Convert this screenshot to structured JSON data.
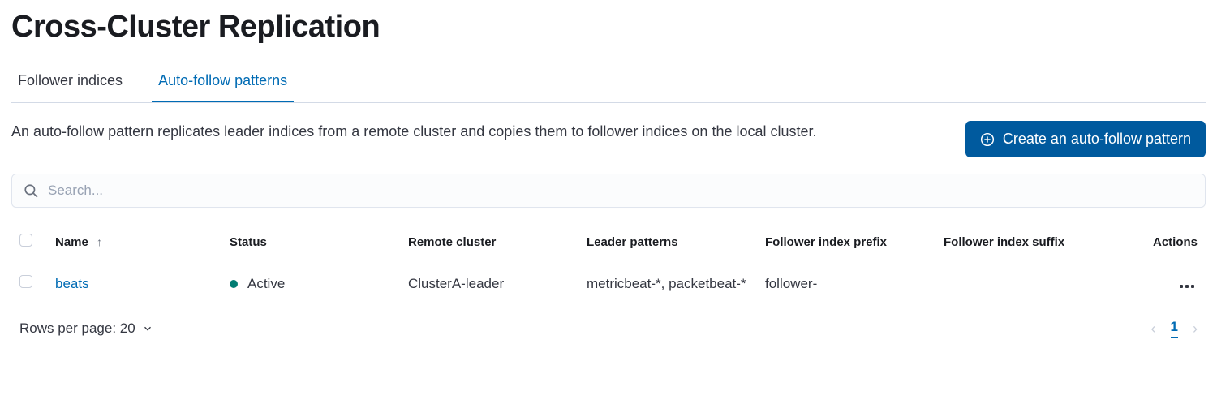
{
  "page": {
    "title": "Cross-Cluster Replication",
    "description": "An auto-follow pattern replicates leader indices from a remote cluster and copies them to follower indices on the local cluster.",
    "create_button": "Create an auto-follow pattern"
  },
  "tabs": {
    "follower": "Follower indices",
    "auto": "Auto-follow patterns"
  },
  "search": {
    "placeholder": "Search..."
  },
  "table": {
    "headers": {
      "name": "Name",
      "status": "Status",
      "remote_cluster": "Remote cluster",
      "leader_patterns": "Leader patterns",
      "prefix": "Follower index prefix",
      "suffix": "Follower index suffix",
      "actions": "Actions"
    },
    "rows": [
      {
        "name": "beats",
        "status": "Active",
        "remote_cluster": "ClusterA-leader",
        "leader_patterns": "metricbeat-*, packetbeat-*",
        "prefix": "follower-",
        "suffix": ""
      }
    ]
  },
  "footer": {
    "rows_label": "Rows per page: 20",
    "page": "1"
  }
}
